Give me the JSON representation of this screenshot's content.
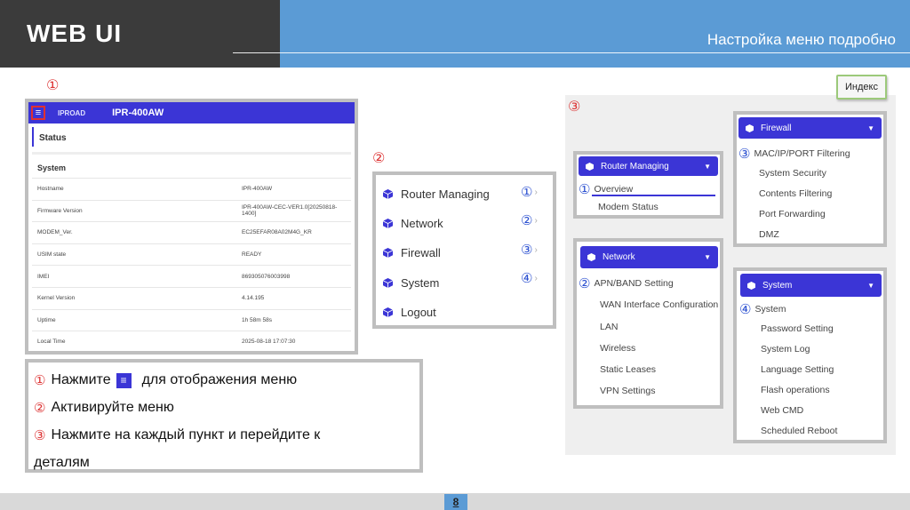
{
  "header": {
    "title": "WEB UI",
    "subtitle": "Настройка меню подробно"
  },
  "markers": {
    "one": "①",
    "two": "②",
    "three": "③",
    "four": "④"
  },
  "index_button": "Индекс",
  "status_panel": {
    "brand": "IPROAD",
    "model": "IPR-400AW",
    "status_title": "Status",
    "system_title": "System",
    "rows": [
      {
        "key": "Hostname",
        "value": "IPR-400AW"
      },
      {
        "key": "Firmware Version",
        "value": "IPR-400AW-CEC-VER1.0[20250818-1400]"
      },
      {
        "key": "MODEM_Ver.",
        "value": "EC25EFAR08A02M4G_KR"
      },
      {
        "key": "USIM state",
        "value": "READY"
      },
      {
        "key": "IMEI",
        "value": "869305076003998"
      },
      {
        "key": "Kernel Version",
        "value": "4.14.195"
      },
      {
        "key": "Uptime",
        "value": "1h 58m 58s"
      },
      {
        "key": "Local Time",
        "value": "2025-08-18 17:07:30"
      }
    ]
  },
  "menu_list": [
    "Router Managing",
    "Network",
    "Firewall",
    "System",
    "Logout"
  ],
  "instructions": {
    "line1_pre": "Нажмите",
    "line1_post": "для отображения меню",
    "line2": "Активируйте меню",
    "line3": "Нажмите на каждый пункт и перейдите к",
    "line4": "деталям"
  },
  "router_card": {
    "title": "Router Managing",
    "items": [
      "Overview",
      "Modem Status"
    ]
  },
  "network_card": {
    "title": "Network",
    "items": [
      "APN/BAND Setting",
      "WAN Interface Configuration",
      "LAN",
      "Wireless",
      "Static Leases",
      "VPN Settings"
    ]
  },
  "firewall_card": {
    "title": "Firewall",
    "items": [
      "MAC/IP/PORT Filtering",
      "System Security",
      "Contents Filtering",
      "Port Forwarding",
      "DMZ"
    ]
  },
  "system_card": {
    "title": "System",
    "items": [
      "System",
      "Password Setting",
      "System Log",
      "Language Setting",
      "Flash operations",
      "Web CMD",
      "Scheduled Reboot"
    ]
  },
  "page_number": "8",
  "colors": {
    "accent": "#3b35d6",
    "header_dark": "#3b3b3b",
    "header_blue": "#5b9bd5",
    "marker_red": "#dd3333",
    "marker_blue": "#2a4fd0"
  }
}
